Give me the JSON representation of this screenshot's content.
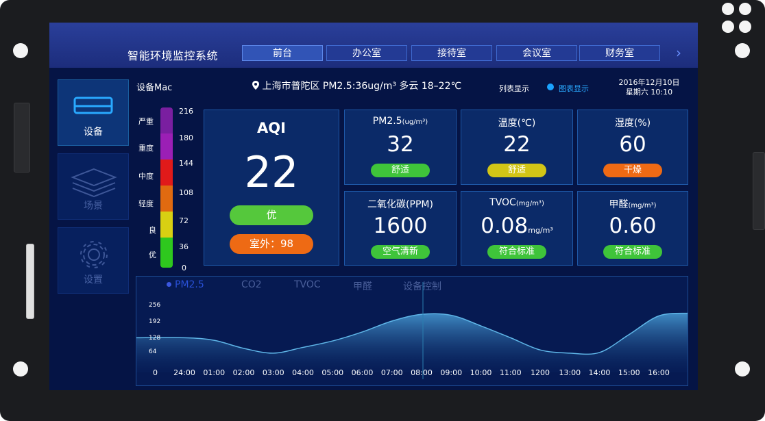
{
  "header": {
    "app_title": "智能环境监控系统",
    "tabs": [
      {
        "label": "前台"
      },
      {
        "label": "办公室"
      },
      {
        "label": "接待室"
      },
      {
        "label": "会议室"
      },
      {
        "label": "财务室"
      }
    ],
    "next_icon": "chevron-right-icon"
  },
  "sidebar": {
    "items": [
      {
        "label": "设备",
        "icon": "air-conditioner-icon"
      },
      {
        "label": "场景",
        "icon": "layers-icon"
      },
      {
        "label": "设置",
        "icon": "gear-icon"
      }
    ]
  },
  "info_bar": {
    "device_name": "设备Mac",
    "location": "上海市普陀区 PM2.5:36ug/m³  多云 18–22℃",
    "view_list": "列表显示",
    "view_chart": "图表显示",
    "date": "2016年12月10日",
    "weekday_time": "星期六 10:10"
  },
  "aqi_scale": {
    "levels": [
      "严重",
      "重度",
      "中度",
      "轻度",
      "良",
      "优"
    ],
    "numbers": [
      "216",
      "180",
      "144",
      "108",
      "72",
      "36",
      "0"
    ],
    "colors": [
      "#7a1fa0",
      "#9b1fb5",
      "#e01a1a",
      "#e06a10",
      "#d8d012",
      "#2ec81e"
    ]
  },
  "aqi": {
    "title": "AQI",
    "value": "22",
    "status": "优",
    "outdoor": "室外：98"
  },
  "metrics": [
    {
      "title": "PM2.5",
      "unit": "(ug/m³)",
      "value": "32",
      "status": "舒适",
      "status_color": "#3fc43a"
    },
    {
      "title": "温度(℃)",
      "unit": "",
      "value": "22",
      "status": "舒适",
      "status_color": "#d2c516"
    },
    {
      "title": "湿度(%)",
      "unit": "",
      "value": "60",
      "status": "干燥",
      "status_color": "#ef6a14"
    },
    {
      "title": "二氧化碳(PPM)",
      "unit": "",
      "value": "1600",
      "status": "空气清新",
      "status_color": "#3fc43a"
    },
    {
      "title": "TVOC",
      "unit": "(mg/m³)",
      "value": "0.08",
      "value_unit": "mg/m³",
      "status": "符合标准",
      "status_color": "#3fc43a"
    },
    {
      "title": "甲醛",
      "unit": "(mg/m³)",
      "value": "0.60",
      "status": "符合标准",
      "status_color": "#3fc43a"
    }
  ],
  "chart_tabs": [
    "PM2.5",
    "CO2",
    "TVOC",
    "甲醛",
    "设备控制"
  ],
  "chart_data": {
    "type": "area",
    "categories": [
      "24:00",
      "01:00",
      "02:00",
      "03:00",
      "04:00",
      "05:00",
      "06:00",
      "07:00",
      "08:00",
      "09:00",
      "10:00",
      "11:00",
      "1200",
      "13:00",
      "14:00",
      "15:00",
      "16:00"
    ],
    "y_ticks": [
      "0",
      "64",
      "128",
      "192",
      "256"
    ],
    "ylim": [
      0,
      256
    ],
    "series": [
      {
        "name": "PM2.5",
        "values": [
          108,
          100,
          75,
          60,
          78,
          98,
          126,
          160,
          181,
          178,
          145,
          108,
          70,
          60,
          62,
          118,
          176
        ]
      }
    ]
  },
  "colors": {
    "accent": "#29a9ff",
    "background": "#051445"
  }
}
